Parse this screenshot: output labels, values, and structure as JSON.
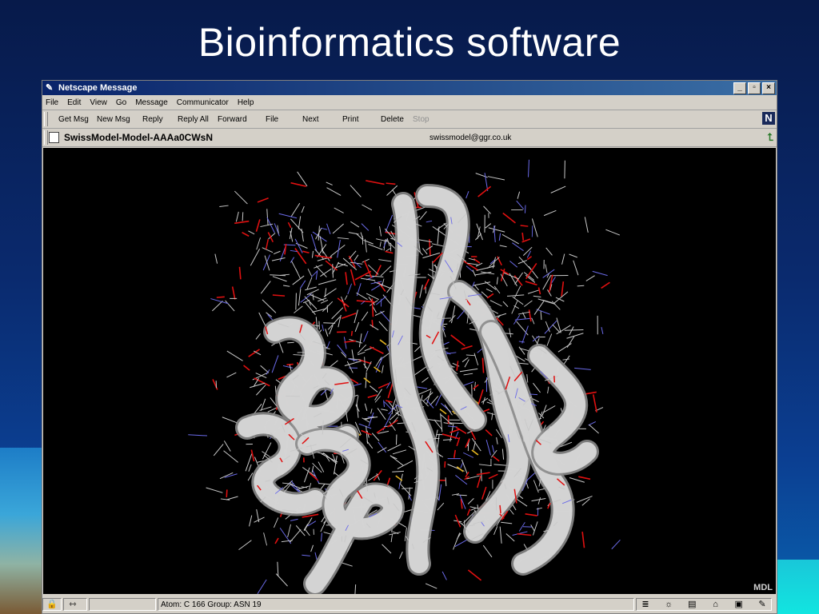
{
  "slide": {
    "title": "Bioinformatics software"
  },
  "window": {
    "title": "Netscape Message",
    "controls": {
      "minimize": "_",
      "restore": "▫",
      "close": "×"
    }
  },
  "menu": [
    "File",
    "Edit",
    "View",
    "Go",
    "Message",
    "Communicator",
    "Help"
  ],
  "toolbar": {
    "buttons": [
      "Get Msg",
      "New Msg",
      "Reply",
      "Reply All",
      "Forward",
      "File",
      "Next",
      "Print",
      "Delete"
    ],
    "disabled_button": "Stop",
    "logo": "N"
  },
  "message": {
    "subject": "SwissModel-Model-AAAa0CWsN",
    "from": "swissmodel@ggr.co.uk"
  },
  "viewer": {
    "watermark": "MDL",
    "description_colors": {
      "ribbon": "#d8d8d8",
      "carbon": "#c8c8c8",
      "oxygen": "#e01010",
      "nitrogen": "#6a6ae8",
      "sulfur": "#e0b020"
    }
  },
  "status": {
    "text": "Atom: C  166  Group: ASN 19"
  },
  "icons": [
    "netscape-icon",
    "document-icon",
    "up-arrow-icon",
    "lock-icon",
    "connection-icon",
    "inbox-icon",
    "navigator-icon",
    "composer-icon",
    "address-book-icon"
  ]
}
